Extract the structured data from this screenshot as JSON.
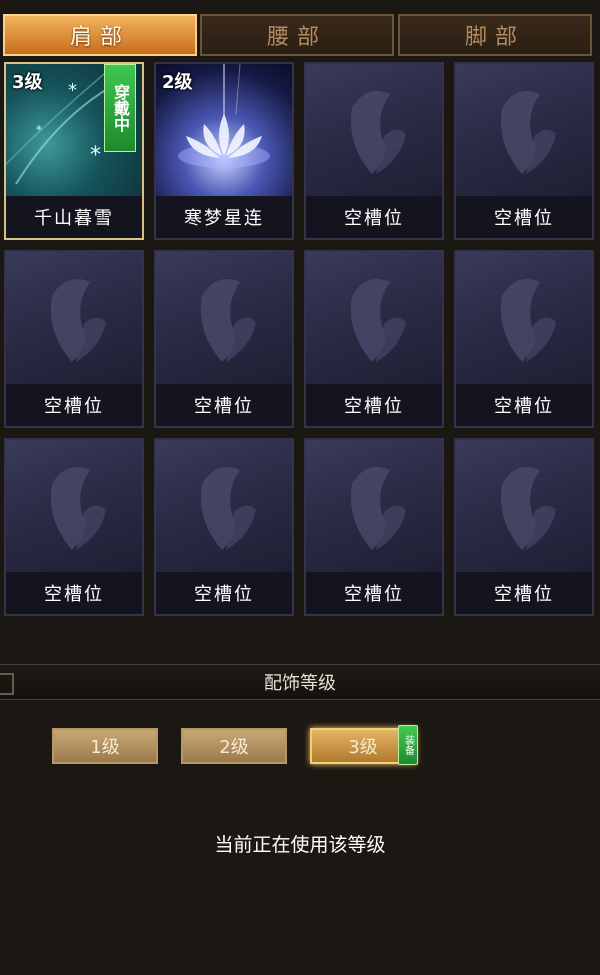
{
  "tabs": [
    {
      "label": "肩部",
      "active": true
    },
    {
      "label": "腰部",
      "active": false
    },
    {
      "label": "脚部",
      "active": false
    }
  ],
  "slots": [
    {
      "name": "千山暮雪",
      "level": "3级",
      "wearing": "穿戴中",
      "art": "teal-snow",
      "selected": true
    },
    {
      "name": "寒梦星连",
      "level": "2级",
      "art": "white-lotus"
    },
    {
      "name": "空槽位",
      "art": "empty-butterfly"
    },
    {
      "name": "空槽位",
      "art": "empty-butterfly"
    },
    {
      "name": "空槽位",
      "art": "empty-butterfly"
    },
    {
      "name": "空槽位",
      "art": "empty-butterfly"
    },
    {
      "name": "空槽位",
      "art": "empty-butterfly"
    },
    {
      "name": "空槽位",
      "art": "empty-butterfly"
    },
    {
      "name": "空槽位",
      "art": "empty-butterfly"
    },
    {
      "name": "空槽位",
      "art": "empty-butterfly"
    },
    {
      "name": "空槽位",
      "art": "empty-butterfly"
    },
    {
      "name": "空槽位",
      "art": "empty-butterfly"
    }
  ],
  "section_title": "配饰等级",
  "level_buttons": [
    {
      "label": "1级",
      "active": false
    },
    {
      "label": "2级",
      "active": false
    },
    {
      "label": "3级",
      "active": true
    }
  ],
  "equipped_badge": "装备",
  "status_text": "当前正在使用该等级",
  "colors": {
    "tab_active": "#e8a04c",
    "badge_green": "#2fa83c",
    "background": "#1b1712"
  }
}
